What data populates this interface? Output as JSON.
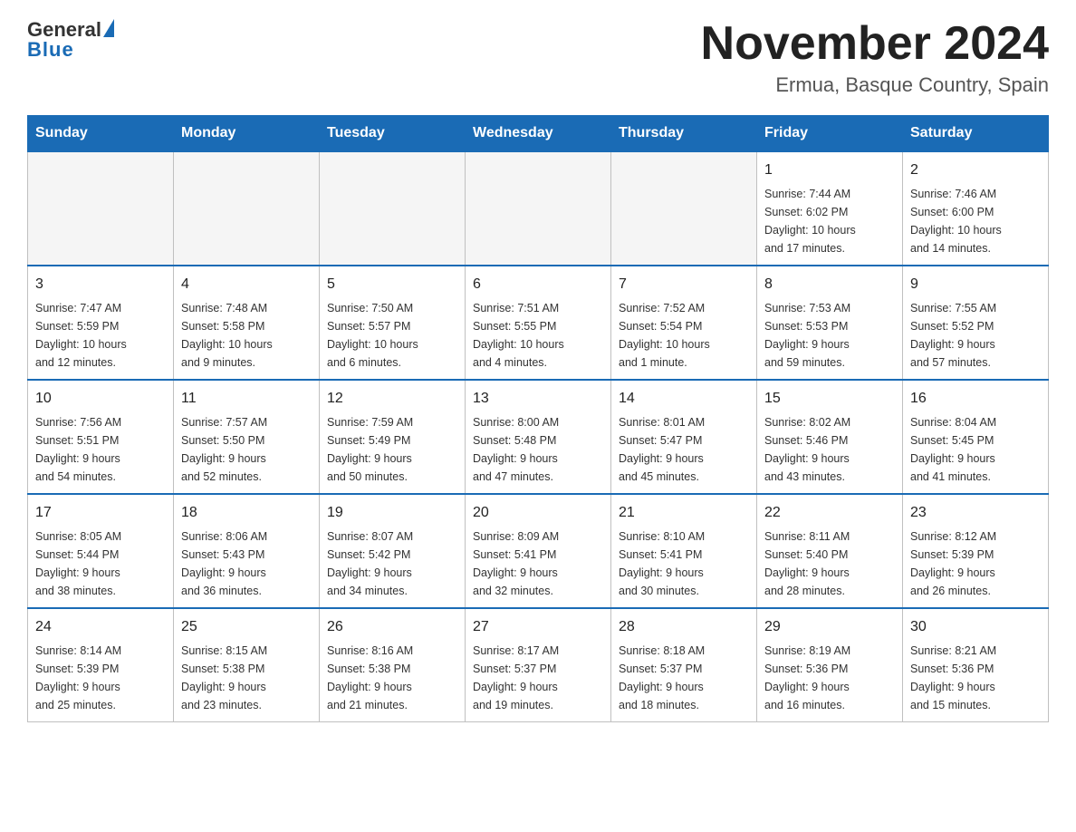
{
  "logo": {
    "general": "General",
    "blue": "Blue"
  },
  "title": "November 2024",
  "subtitle": "Ermua, Basque Country, Spain",
  "days_of_week": [
    "Sunday",
    "Monday",
    "Tuesday",
    "Wednesday",
    "Thursday",
    "Friday",
    "Saturday"
  ],
  "weeks": [
    [
      {
        "day": "",
        "info": ""
      },
      {
        "day": "",
        "info": ""
      },
      {
        "day": "",
        "info": ""
      },
      {
        "day": "",
        "info": ""
      },
      {
        "day": "",
        "info": ""
      },
      {
        "day": "1",
        "info": "Sunrise: 7:44 AM\nSunset: 6:02 PM\nDaylight: 10 hours\nand 17 minutes."
      },
      {
        "day": "2",
        "info": "Sunrise: 7:46 AM\nSunset: 6:00 PM\nDaylight: 10 hours\nand 14 minutes."
      }
    ],
    [
      {
        "day": "3",
        "info": "Sunrise: 7:47 AM\nSunset: 5:59 PM\nDaylight: 10 hours\nand 12 minutes."
      },
      {
        "day": "4",
        "info": "Sunrise: 7:48 AM\nSunset: 5:58 PM\nDaylight: 10 hours\nand 9 minutes."
      },
      {
        "day": "5",
        "info": "Sunrise: 7:50 AM\nSunset: 5:57 PM\nDaylight: 10 hours\nand 6 minutes."
      },
      {
        "day": "6",
        "info": "Sunrise: 7:51 AM\nSunset: 5:55 PM\nDaylight: 10 hours\nand 4 minutes."
      },
      {
        "day": "7",
        "info": "Sunrise: 7:52 AM\nSunset: 5:54 PM\nDaylight: 10 hours\nand 1 minute."
      },
      {
        "day": "8",
        "info": "Sunrise: 7:53 AM\nSunset: 5:53 PM\nDaylight: 9 hours\nand 59 minutes."
      },
      {
        "day": "9",
        "info": "Sunrise: 7:55 AM\nSunset: 5:52 PM\nDaylight: 9 hours\nand 57 minutes."
      }
    ],
    [
      {
        "day": "10",
        "info": "Sunrise: 7:56 AM\nSunset: 5:51 PM\nDaylight: 9 hours\nand 54 minutes."
      },
      {
        "day": "11",
        "info": "Sunrise: 7:57 AM\nSunset: 5:50 PM\nDaylight: 9 hours\nand 52 minutes."
      },
      {
        "day": "12",
        "info": "Sunrise: 7:59 AM\nSunset: 5:49 PM\nDaylight: 9 hours\nand 50 minutes."
      },
      {
        "day": "13",
        "info": "Sunrise: 8:00 AM\nSunset: 5:48 PM\nDaylight: 9 hours\nand 47 minutes."
      },
      {
        "day": "14",
        "info": "Sunrise: 8:01 AM\nSunset: 5:47 PM\nDaylight: 9 hours\nand 45 minutes."
      },
      {
        "day": "15",
        "info": "Sunrise: 8:02 AM\nSunset: 5:46 PM\nDaylight: 9 hours\nand 43 minutes."
      },
      {
        "day": "16",
        "info": "Sunrise: 8:04 AM\nSunset: 5:45 PM\nDaylight: 9 hours\nand 41 minutes."
      }
    ],
    [
      {
        "day": "17",
        "info": "Sunrise: 8:05 AM\nSunset: 5:44 PM\nDaylight: 9 hours\nand 38 minutes."
      },
      {
        "day": "18",
        "info": "Sunrise: 8:06 AM\nSunset: 5:43 PM\nDaylight: 9 hours\nand 36 minutes."
      },
      {
        "day": "19",
        "info": "Sunrise: 8:07 AM\nSunset: 5:42 PM\nDaylight: 9 hours\nand 34 minutes."
      },
      {
        "day": "20",
        "info": "Sunrise: 8:09 AM\nSunset: 5:41 PM\nDaylight: 9 hours\nand 32 minutes."
      },
      {
        "day": "21",
        "info": "Sunrise: 8:10 AM\nSunset: 5:41 PM\nDaylight: 9 hours\nand 30 minutes."
      },
      {
        "day": "22",
        "info": "Sunrise: 8:11 AM\nSunset: 5:40 PM\nDaylight: 9 hours\nand 28 minutes."
      },
      {
        "day": "23",
        "info": "Sunrise: 8:12 AM\nSunset: 5:39 PM\nDaylight: 9 hours\nand 26 minutes."
      }
    ],
    [
      {
        "day": "24",
        "info": "Sunrise: 8:14 AM\nSunset: 5:39 PM\nDaylight: 9 hours\nand 25 minutes."
      },
      {
        "day": "25",
        "info": "Sunrise: 8:15 AM\nSunset: 5:38 PM\nDaylight: 9 hours\nand 23 minutes."
      },
      {
        "day": "26",
        "info": "Sunrise: 8:16 AM\nSunset: 5:38 PM\nDaylight: 9 hours\nand 21 minutes."
      },
      {
        "day": "27",
        "info": "Sunrise: 8:17 AM\nSunset: 5:37 PM\nDaylight: 9 hours\nand 19 minutes."
      },
      {
        "day": "28",
        "info": "Sunrise: 8:18 AM\nSunset: 5:37 PM\nDaylight: 9 hours\nand 18 minutes."
      },
      {
        "day": "29",
        "info": "Sunrise: 8:19 AM\nSunset: 5:36 PM\nDaylight: 9 hours\nand 16 minutes."
      },
      {
        "day": "30",
        "info": "Sunrise: 8:21 AM\nSunset: 5:36 PM\nDaylight: 9 hours\nand 15 minutes."
      }
    ]
  ]
}
